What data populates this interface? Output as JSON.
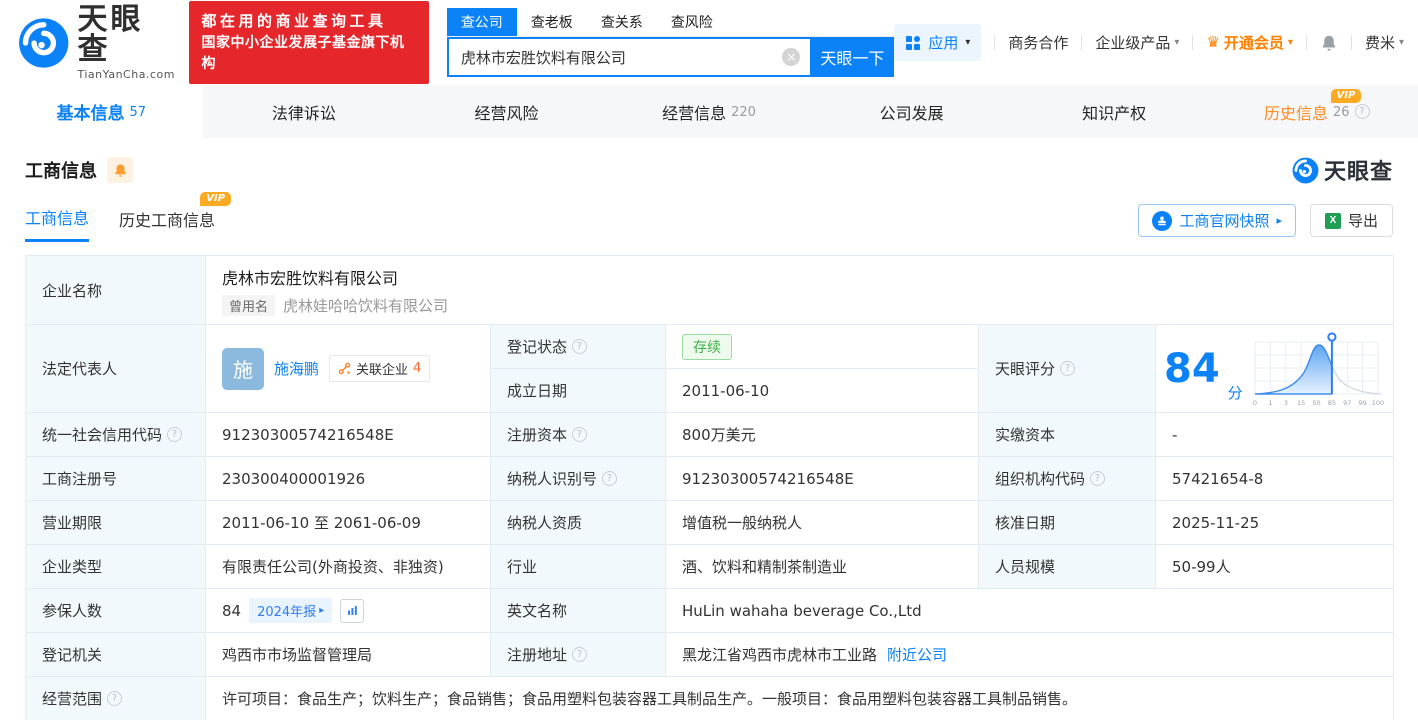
{
  "brand": {
    "name": "天眼查",
    "domain": "TianYanCha.com",
    "slogan_line1": "都在用的商业查询工具",
    "slogan_line2": "国家中小企业发展子基金旗下机构"
  },
  "search": {
    "tabs": [
      "查公司",
      "查老板",
      "查关系",
      "查风险"
    ],
    "value": "虎林市宏胜饮料有限公司",
    "button": "天眼一下"
  },
  "topnav": {
    "apps": "应用",
    "cooperation": "商务合作",
    "enterprise": "企业级产品",
    "membership": "开通会员",
    "username": "费米"
  },
  "tabs": [
    {
      "label": "基本信息",
      "count": "57"
    },
    {
      "label": "法律诉讼",
      "count": ""
    },
    {
      "label": "经营风险",
      "count": ""
    },
    {
      "label": "经营信息",
      "count": "220"
    },
    {
      "label": "公司发展",
      "count": ""
    },
    {
      "label": "知识产权",
      "count": ""
    },
    {
      "label": "历史信息",
      "count": "26",
      "vip": "VIP"
    }
  ],
  "section": {
    "title": "工商信息",
    "subtabs": [
      {
        "label": "工商信息"
      },
      {
        "label": "历史工商信息",
        "vip": "VIP"
      }
    ],
    "snapshot_button": "工商官网快照",
    "export_button": "导出",
    "watermark": "天眼查"
  },
  "fields": {
    "company_name_label": "企业名称",
    "company_name": "虎林市宏胜饮料有限公司",
    "former_name_badge": "曾用名",
    "former_name": "虎林娃哈哈饮料有限公司",
    "legal_rep_label": "法定代表人",
    "legal_rep_avatar": "施",
    "legal_rep_name": "施海鹏",
    "related_companies_label": "关联企业",
    "related_companies_count": "4",
    "reg_status_label": "登记状态",
    "reg_status": "存续",
    "establish_date_label": "成立日期",
    "establish_date": "2011-06-10",
    "score_label": "天眼评分",
    "score_value": "84",
    "score_unit": "分",
    "score_axis": [
      "0",
      "1",
      "3",
      "15",
      "50",
      "85",
      "97",
      "99",
      "100"
    ],
    "credit_code_label": "统一社会信用代码",
    "credit_code": "91230300574216548E",
    "reg_capital_label": "注册资本",
    "reg_capital": "800万美元",
    "paid_capital_label": "实缴资本",
    "paid_capital": "-",
    "reg_number_label": "工商注册号",
    "reg_number": "230300400001926",
    "taxpayer_id_label": "纳税人识别号",
    "taxpayer_id": "91230300574216548E",
    "org_code_label": "组织机构代码",
    "org_code": "57421654-8",
    "business_term_label": "营业期限",
    "business_term": "2011-06-10 至 2061-06-09",
    "taxpayer_quality_label": "纳税人资质",
    "taxpayer_quality": "增值税一般纳税人",
    "approval_date_label": "核准日期",
    "approval_date": "2025-11-25",
    "company_type_label": "企业类型",
    "company_type": "有限责任公司(外商投资、非独资)",
    "industry_label": "行业",
    "industry": "酒、饮料和精制茶制造业",
    "staff_size_label": "人员规模",
    "staff_size": "50-99人",
    "insured_label": "参保人数",
    "insured_count": "84",
    "insured_badge": "2024年报",
    "english_name_label": "英文名称",
    "english_name": "HuLin wahaha beverage Co.,Ltd",
    "reg_authority_label": "登记机关",
    "reg_authority": "鸡西市市场监督管理局",
    "reg_address_label": "注册地址",
    "reg_address": "黑龙江省鸡西市虎林市工业路",
    "nearby_link": "附近公司",
    "business_scope_label": "经营范围",
    "business_scope": "许可项目：食品生产；饮料生产；食品销售；食品用塑料包装容器工具制品生产。一般项目：食品用塑料包装容器工具制品销售。"
  }
}
